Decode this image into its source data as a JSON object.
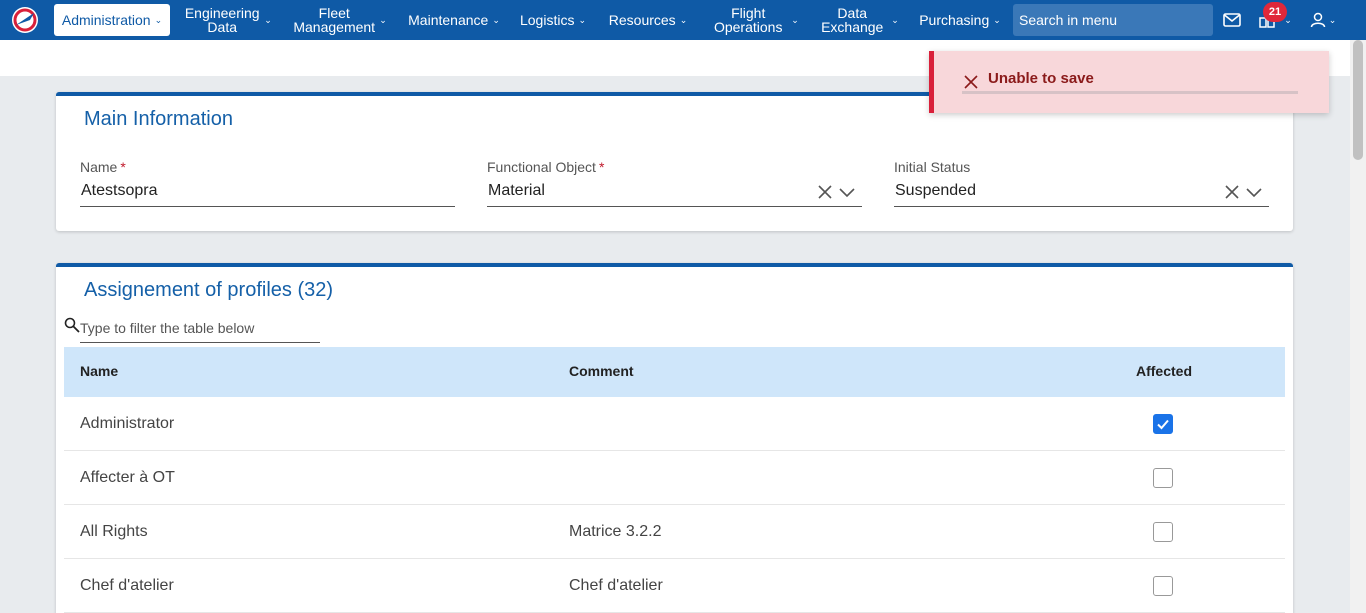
{
  "nav": {
    "items": [
      {
        "label": "Administration",
        "active": true
      },
      {
        "label": "Engineering Data"
      },
      {
        "label": "Fleet Management"
      },
      {
        "label": "Maintenance"
      },
      {
        "label": "Logistics"
      },
      {
        "label": "Resources"
      },
      {
        "label": "Flight Operations"
      },
      {
        "label": "Data Exchange"
      },
      {
        "label": "Purchasing"
      }
    ],
    "search_placeholder": "Search in menu",
    "notification_count": "21",
    "icons": [
      "mail-icon",
      "dashboard-icon",
      "user-icon"
    ],
    "bg_color": "#0f5aa6"
  },
  "toast": {
    "message": "Unable to save",
    "color": "#d9203a"
  },
  "main_info": {
    "title": "Main Information",
    "fields": {
      "name": {
        "label": "Name",
        "value": "Atestsopra",
        "required": true
      },
      "functional_object": {
        "label": "Functional Object",
        "value": "Material",
        "required": true
      },
      "initial_status": {
        "label": "Initial Status",
        "value": "Suspended",
        "required": false
      }
    }
  },
  "profiles": {
    "title": "Assignement of profiles (32)",
    "filter_placeholder": "Type to filter the table below",
    "columns": {
      "name": "Name",
      "comment": "Comment",
      "affected": "Affected"
    },
    "rows": [
      {
        "name": "Administrator",
        "comment": "",
        "affected": true
      },
      {
        "name": "Affecter à OT",
        "comment": "",
        "affected": false
      },
      {
        "name": "All Rights",
        "comment": "Matrice 3.2.2",
        "affected": false
      },
      {
        "name": "Chef d'atelier",
        "comment": "Chef d'atelier",
        "affected": false
      }
    ]
  }
}
